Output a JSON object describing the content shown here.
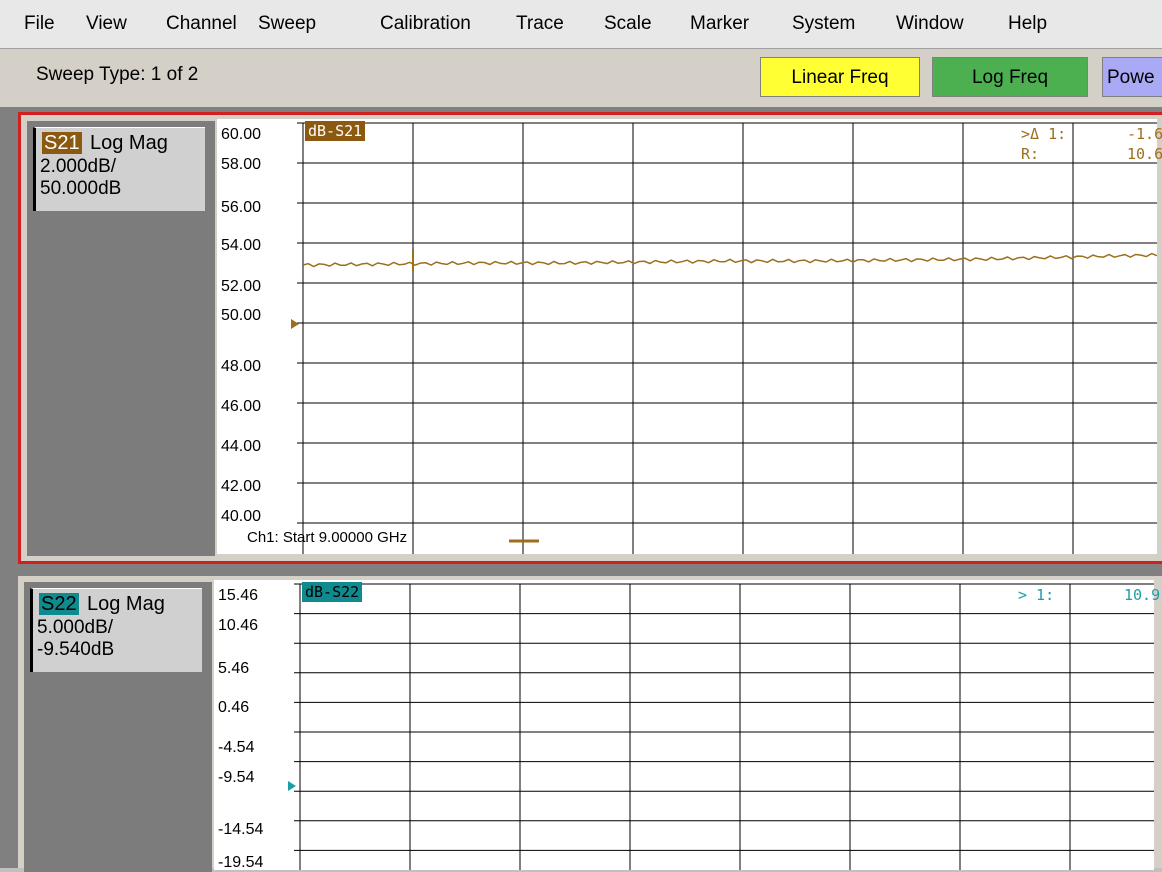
{
  "menu": [
    "File",
    "View",
    "Channel",
    "Sweep",
    "Calibration",
    "Trace",
    "Scale",
    "Marker",
    "System",
    "Window",
    "Help"
  ],
  "toolbar": {
    "sweep_type": "Sweep Type: 1 of 2",
    "buttons": [
      {
        "label": "Linear Freq",
        "color": "#ffff33"
      },
      {
        "label": "Log Freq",
        "color": "#4caf50"
      },
      {
        "label": "Powe",
        "color": "#a9a9f5"
      }
    ]
  },
  "traces": [
    {
      "param": "S21",
      "format": "Log Mag",
      "scale": "2.000dB/",
      "ref": "50.000dB",
      "label": "dB-S21",
      "color": "#9c6f1f",
      "tag_bg": "#8b5a10",
      "tag_fg": "#ffffff",
      "yticks": [
        "60.00",
        "58.00",
        "56.00",
        "54.00",
        "52.00",
        "50.00",
        "48.00",
        "46.00",
        "44.00",
        "42.00",
        "40.00"
      ],
      "markers": [
        [
          ">Δ 1:",
          "-1.6"
        ],
        [
          "R:",
          "10.6"
        ]
      ],
      "channel_start": "Ch1: Start  9.00000 GHz"
    },
    {
      "param": "S22",
      "format": "Log Mag",
      "scale": "5.000dB/",
      "ref": "-9.540dB",
      "label": "dB-S22",
      "color": "#1a9fa8",
      "tag_bg": "#0f8a8f",
      "tag_fg": "#000000",
      "yticks": [
        "15.46",
        "10.46",
        "5.46",
        "0.46",
        "-4.54",
        "-9.54",
        "-14.54",
        "-19.54"
      ],
      "markers": [
        [
          "> 1:",
          "10.9"
        ]
      ]
    }
  ],
  "chart_data": [
    {
      "type": "line",
      "title": "dB-S21",
      "ylim": [
        40,
        60
      ],
      "reference_level": 50,
      "series": [
        {
          "name": "dB-S21",
          "values": [
            52.9,
            52.95,
            53.0,
            53.0,
            53.05,
            53.1,
            53.1,
            53.15,
            53.2,
            53.3,
            53.4
          ]
        }
      ]
    },
    {
      "type": "line",
      "title": "dB-S22",
      "ylim": [
        -19.54,
        15.46
      ],
      "reference_level": -9.54,
      "series": []
    }
  ]
}
